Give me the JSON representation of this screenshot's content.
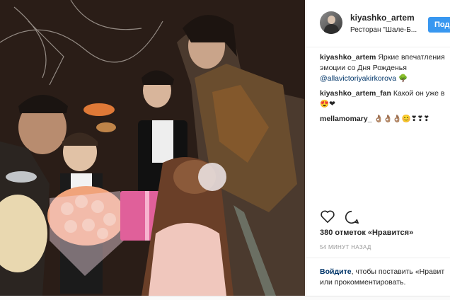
{
  "header": {
    "username": "kiyashko_artem",
    "location": "Ресторан \"Шале-Б...",
    "follow_label": "Подп"
  },
  "comments": [
    {
      "user": "kiyashko_artem",
      "line1": "Яркие впечатления",
      "line2": "эмоции со Дня Рожденья",
      "mention": "@allavictoriyakirkorova",
      "emoji": "🌳"
    },
    {
      "user": "kiyashko_artem_fan",
      "text": "Какой он уже в",
      "emoji": "😍❤"
    },
    {
      "user": "mellamomary_",
      "emoji": "👌🏽👌🏽👌🏽😊❣❣❣"
    }
  ],
  "actions": {
    "like_icon": "heart-icon",
    "comment_icon": "comment-icon"
  },
  "likes": "380 отметок «Нравится»",
  "time": "54 МИНУТ НАЗАД",
  "login": {
    "link": "Войдите",
    "text1": ", чтобы поставить «Нравит",
    "text2": "или прокомментировать."
  },
  "colors": {
    "accent": "#3897f0",
    "link": "#003569",
    "text": "#262626",
    "muted": "#999999"
  }
}
